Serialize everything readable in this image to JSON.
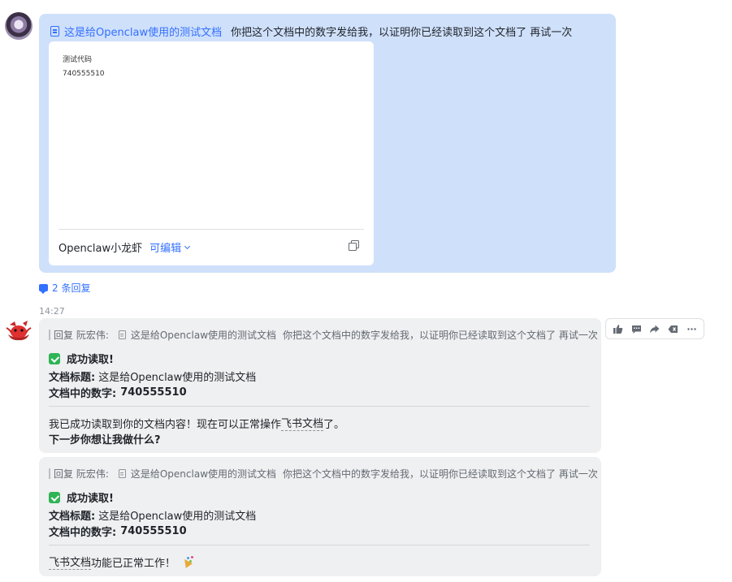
{
  "message1": {
    "doc_link": "这是给Openclaw使用的测试文档",
    "text": "你把这个文档中的数字发给我，以证明你已经读取到这个文档了 再试一次",
    "card": {
      "preview_title": "测试代码",
      "preview_number": "740555510",
      "owner": "Openclaw小龙虾",
      "permission": "可编辑"
    }
  },
  "thread": {
    "replies_label": "2 条回复"
  },
  "timestamp": "14:27",
  "bot_messages": [
    {
      "quote_prefix": "回复 阮宏伟:",
      "quote_doc": "这是给Openclaw使用的测试文档",
      "quote_text": "你把这个文档中的数字发给我，以证明你已经读取到这个文档了 再试一次",
      "status": "成功读取!",
      "title_label": "文档标题:",
      "title_value": "这是给Openclaw使用的测试文档",
      "number_label": "文档中的数字:",
      "number_value": "740555510",
      "body_a": "我已成功读取到你的文档内容！现在可以正常操作",
      "body_b": "飞书文档",
      "body_c": "了。",
      "question": "下一步你想让我做什么?"
    },
    {
      "quote_prefix": "回复 阮宏伟:",
      "quote_doc": "这是给Openclaw使用的测试文档",
      "quote_text": "你把这个文档中的数字发给我，以证明你已经读取到这个文档了 再试一次",
      "status": "成功读取!",
      "title_label": "文档标题:",
      "title_value": "这是给Openclaw使用的测试文档",
      "number_label": "文档中的数字:",
      "number_value": "740555510",
      "body_a": "飞书文档",
      "body_b": "功能已正常工作！"
    }
  ],
  "icons": {
    "toolbar": [
      "thumbs-up-icon",
      "comment-icon",
      "forward-icon",
      "backspace-icon",
      "more-icon"
    ]
  },
  "colors": {
    "accent": "#3370ff",
    "own_bubble": "#cfe0fb",
    "bot_bubble": "#eff0f1",
    "success": "#2fb455"
  }
}
